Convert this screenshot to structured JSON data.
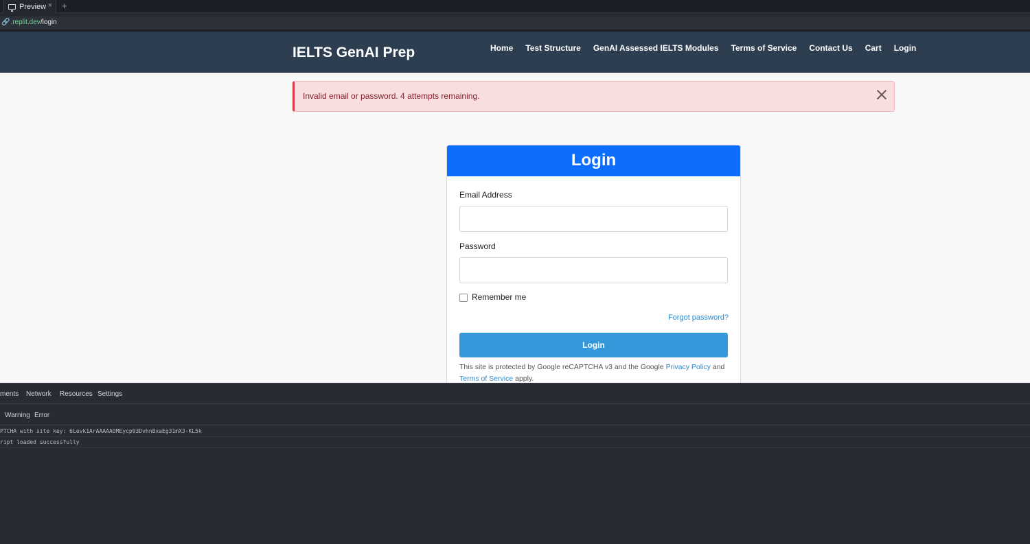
{
  "browser": {
    "tab_label": "Preview",
    "tab_close": "×",
    "new_tab": "+",
    "url_domain": ".replit.dev",
    "url_path": "/login"
  },
  "site": {
    "brand": "IELTS GenAI Prep",
    "nav": [
      "Home",
      "Test Structure",
      "GenAI Assessed IELTS Modules",
      "Terms of Service",
      "Contact Us",
      "Cart",
      "Login"
    ]
  },
  "alert": {
    "message": "Invalid email or password. 4 attempts remaining."
  },
  "login": {
    "title": "Login",
    "email_label": "Email Address",
    "email_value": "",
    "password_label": "Password",
    "password_value": "",
    "remember_label": "Remember me",
    "remember_checked": false,
    "forgot_link": "Forgot password?",
    "submit_label": "Login",
    "recaptcha_prefix": "This site is protected by Google reCAPTCHA v3 and the Google",
    "privacy_link": "Privacy Policy",
    "and_text": "and",
    "terms_link": "Terms of Service",
    "apply_text": "apply."
  },
  "devtools": {
    "tabs": [
      "ments",
      "Network",
      "Resources",
      "Settings"
    ],
    "filters": [
      "Warning",
      "Error"
    ],
    "logs": [
      "PTCHA with site key: 6Levk1ArAAAAAOMEycp93Dvhn8xaEg31mX3-KL5k",
      "ript loaded successfully"
    ]
  }
}
